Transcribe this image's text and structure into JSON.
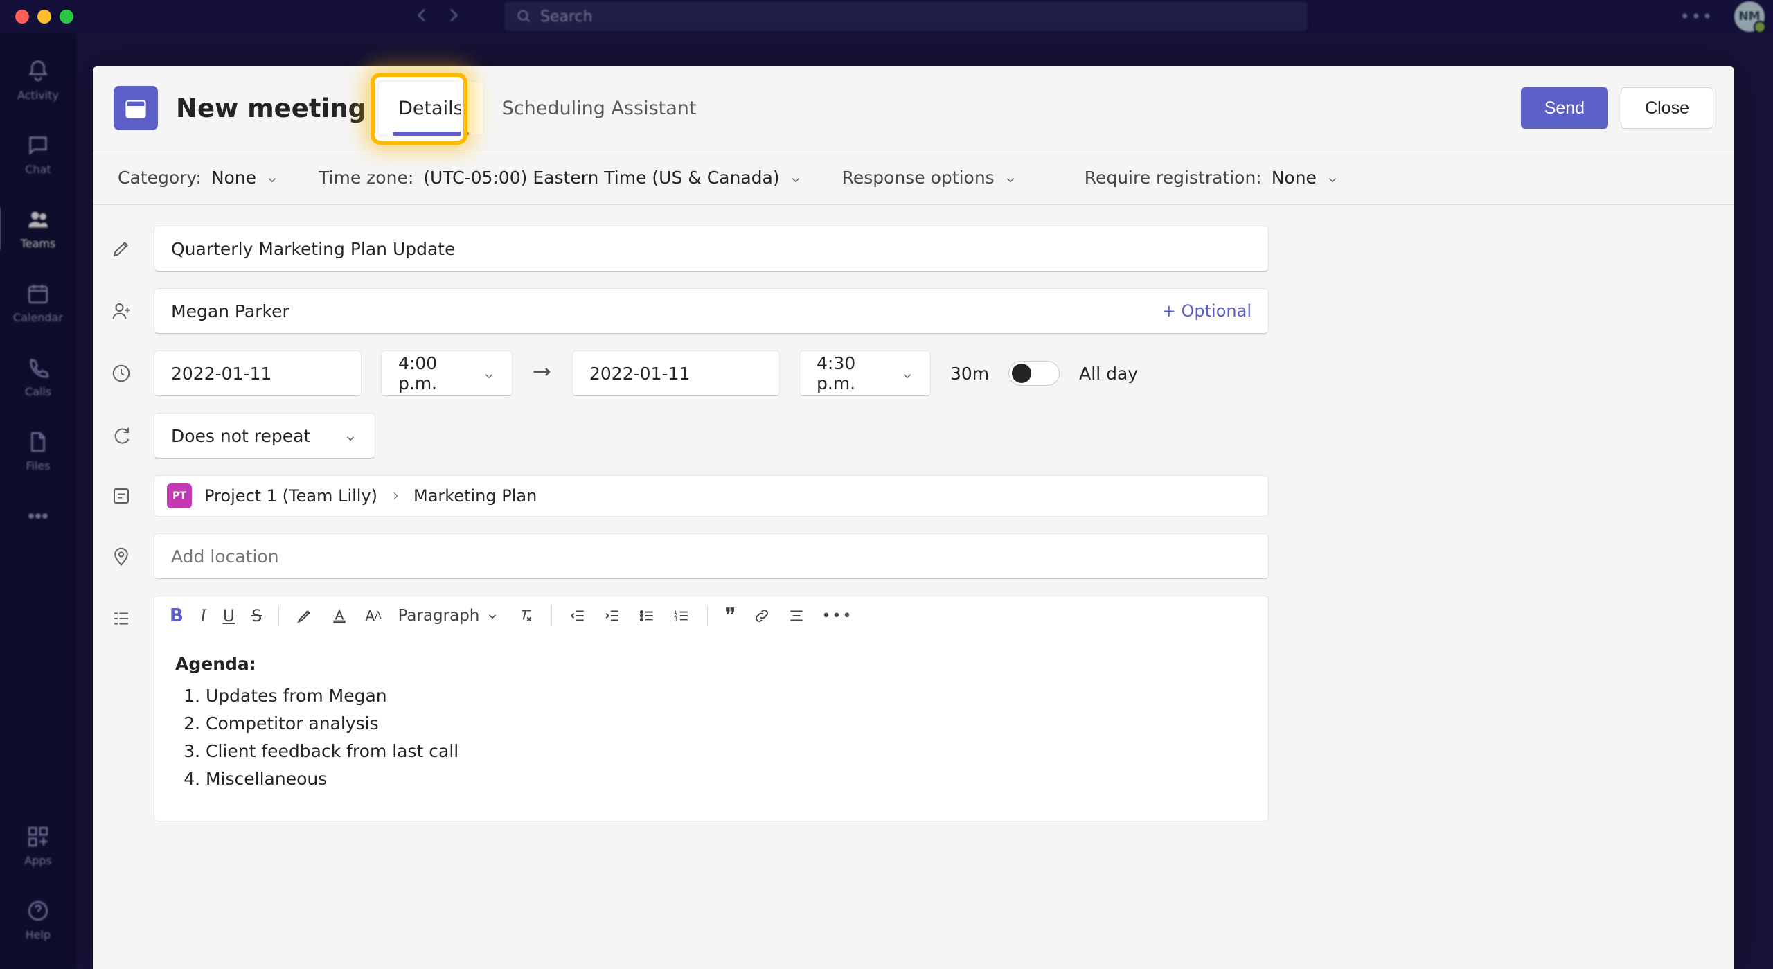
{
  "titlebar": {
    "search_placeholder": "Search",
    "avatar_initials": "NM"
  },
  "rail": {
    "activity": "Activity",
    "chat": "Chat",
    "teams": "Teams",
    "calendar": "Calendar",
    "calls": "Calls",
    "files": "Files",
    "apps": "Apps",
    "help": "Help"
  },
  "modal": {
    "title": "New meeting",
    "tabs": {
      "details": "Details",
      "scheduling": "Scheduling Assistant"
    },
    "send": "Send",
    "close": "Close"
  },
  "options": {
    "category_label": "Category:",
    "category_value": "None",
    "tz_label": "Time zone:",
    "tz_value": "(UTC-05:00) Eastern Time (US & Canada)",
    "response_label": "Response options",
    "registration_label": "Require registration:",
    "registration_value": "None"
  },
  "form": {
    "title_value": "Quarterly Marketing Plan Update",
    "attendee_value": "Megan Parker",
    "optional_link": "+ Optional",
    "start_date": "2022-01-11",
    "start_time": "4:00 p.m.",
    "end_date": "2022-01-11",
    "end_time": "4:30 p.m.",
    "duration": "30m",
    "allday_label": "All day",
    "recurrence_value": "Does not repeat",
    "channel_team": "Project 1 (Team Lilly)",
    "channel_sub": "Marketing Plan",
    "location_placeholder": "Add location"
  },
  "rte": {
    "paragraph": "Paragraph",
    "agenda_heading": "Agenda:",
    "items": [
      "Updates from Megan",
      "Competitor analysis",
      "Client feedback from last call",
      "Miscellaneous"
    ]
  }
}
